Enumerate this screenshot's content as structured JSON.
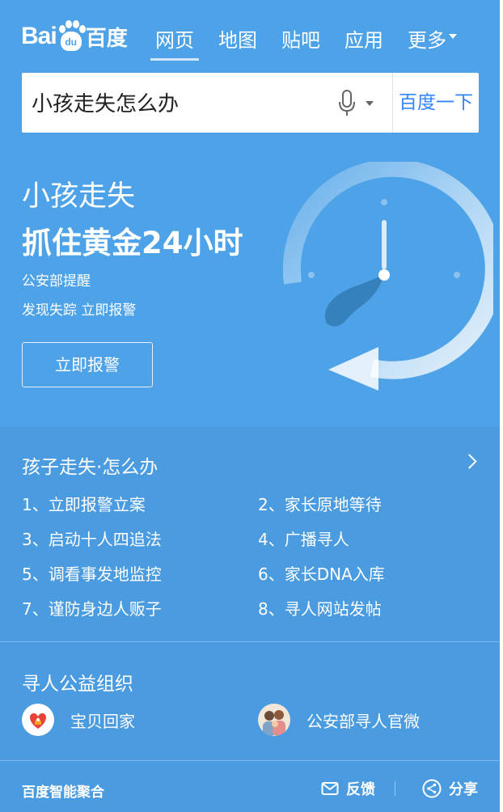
{
  "header": {
    "logo_bai": "Bai",
    "logo_du": "du",
    "logo_cn": "百度",
    "tabs": [
      {
        "label": "网页",
        "active": true
      },
      {
        "label": "地图"
      },
      {
        "label": "贴吧"
      },
      {
        "label": "应用"
      }
    ],
    "more_label": "更多"
  },
  "search": {
    "query": "小孩走失怎么办",
    "button_label": "百度一下"
  },
  "hero": {
    "title_line1": "小孩走失",
    "title_line2": "抓住黄金24小时",
    "note_line1": "公安部提醒",
    "note_line2": "发现失踪 立即报警",
    "button_label": "立即报警"
  },
  "tips": {
    "title": "孩子走失·怎么办",
    "items": [
      "1、立即报警立案",
      "2、家长原地等待",
      "3、启动十人四追法",
      "4、广播寻人",
      "5、调看事发地监控",
      "6、家长DNA入库",
      "7、谨防身边人贩子",
      "8、寻人网站发帖"
    ]
  },
  "orgs": {
    "title": "寻人公益组织",
    "items": [
      {
        "label": "宝贝回家",
        "icon": "baobei-huijia-logo-icon"
      },
      {
        "label": "公安部寻人官微",
        "icon": "family-avatar-icon"
      }
    ]
  },
  "footer": {
    "brand": "百度智能聚合",
    "feedback_label": "反馈",
    "share_label": "分享"
  },
  "colors": {
    "background": "#4da2e8",
    "card_background": "#4a9be0",
    "search_button_text": "#3385ff"
  }
}
